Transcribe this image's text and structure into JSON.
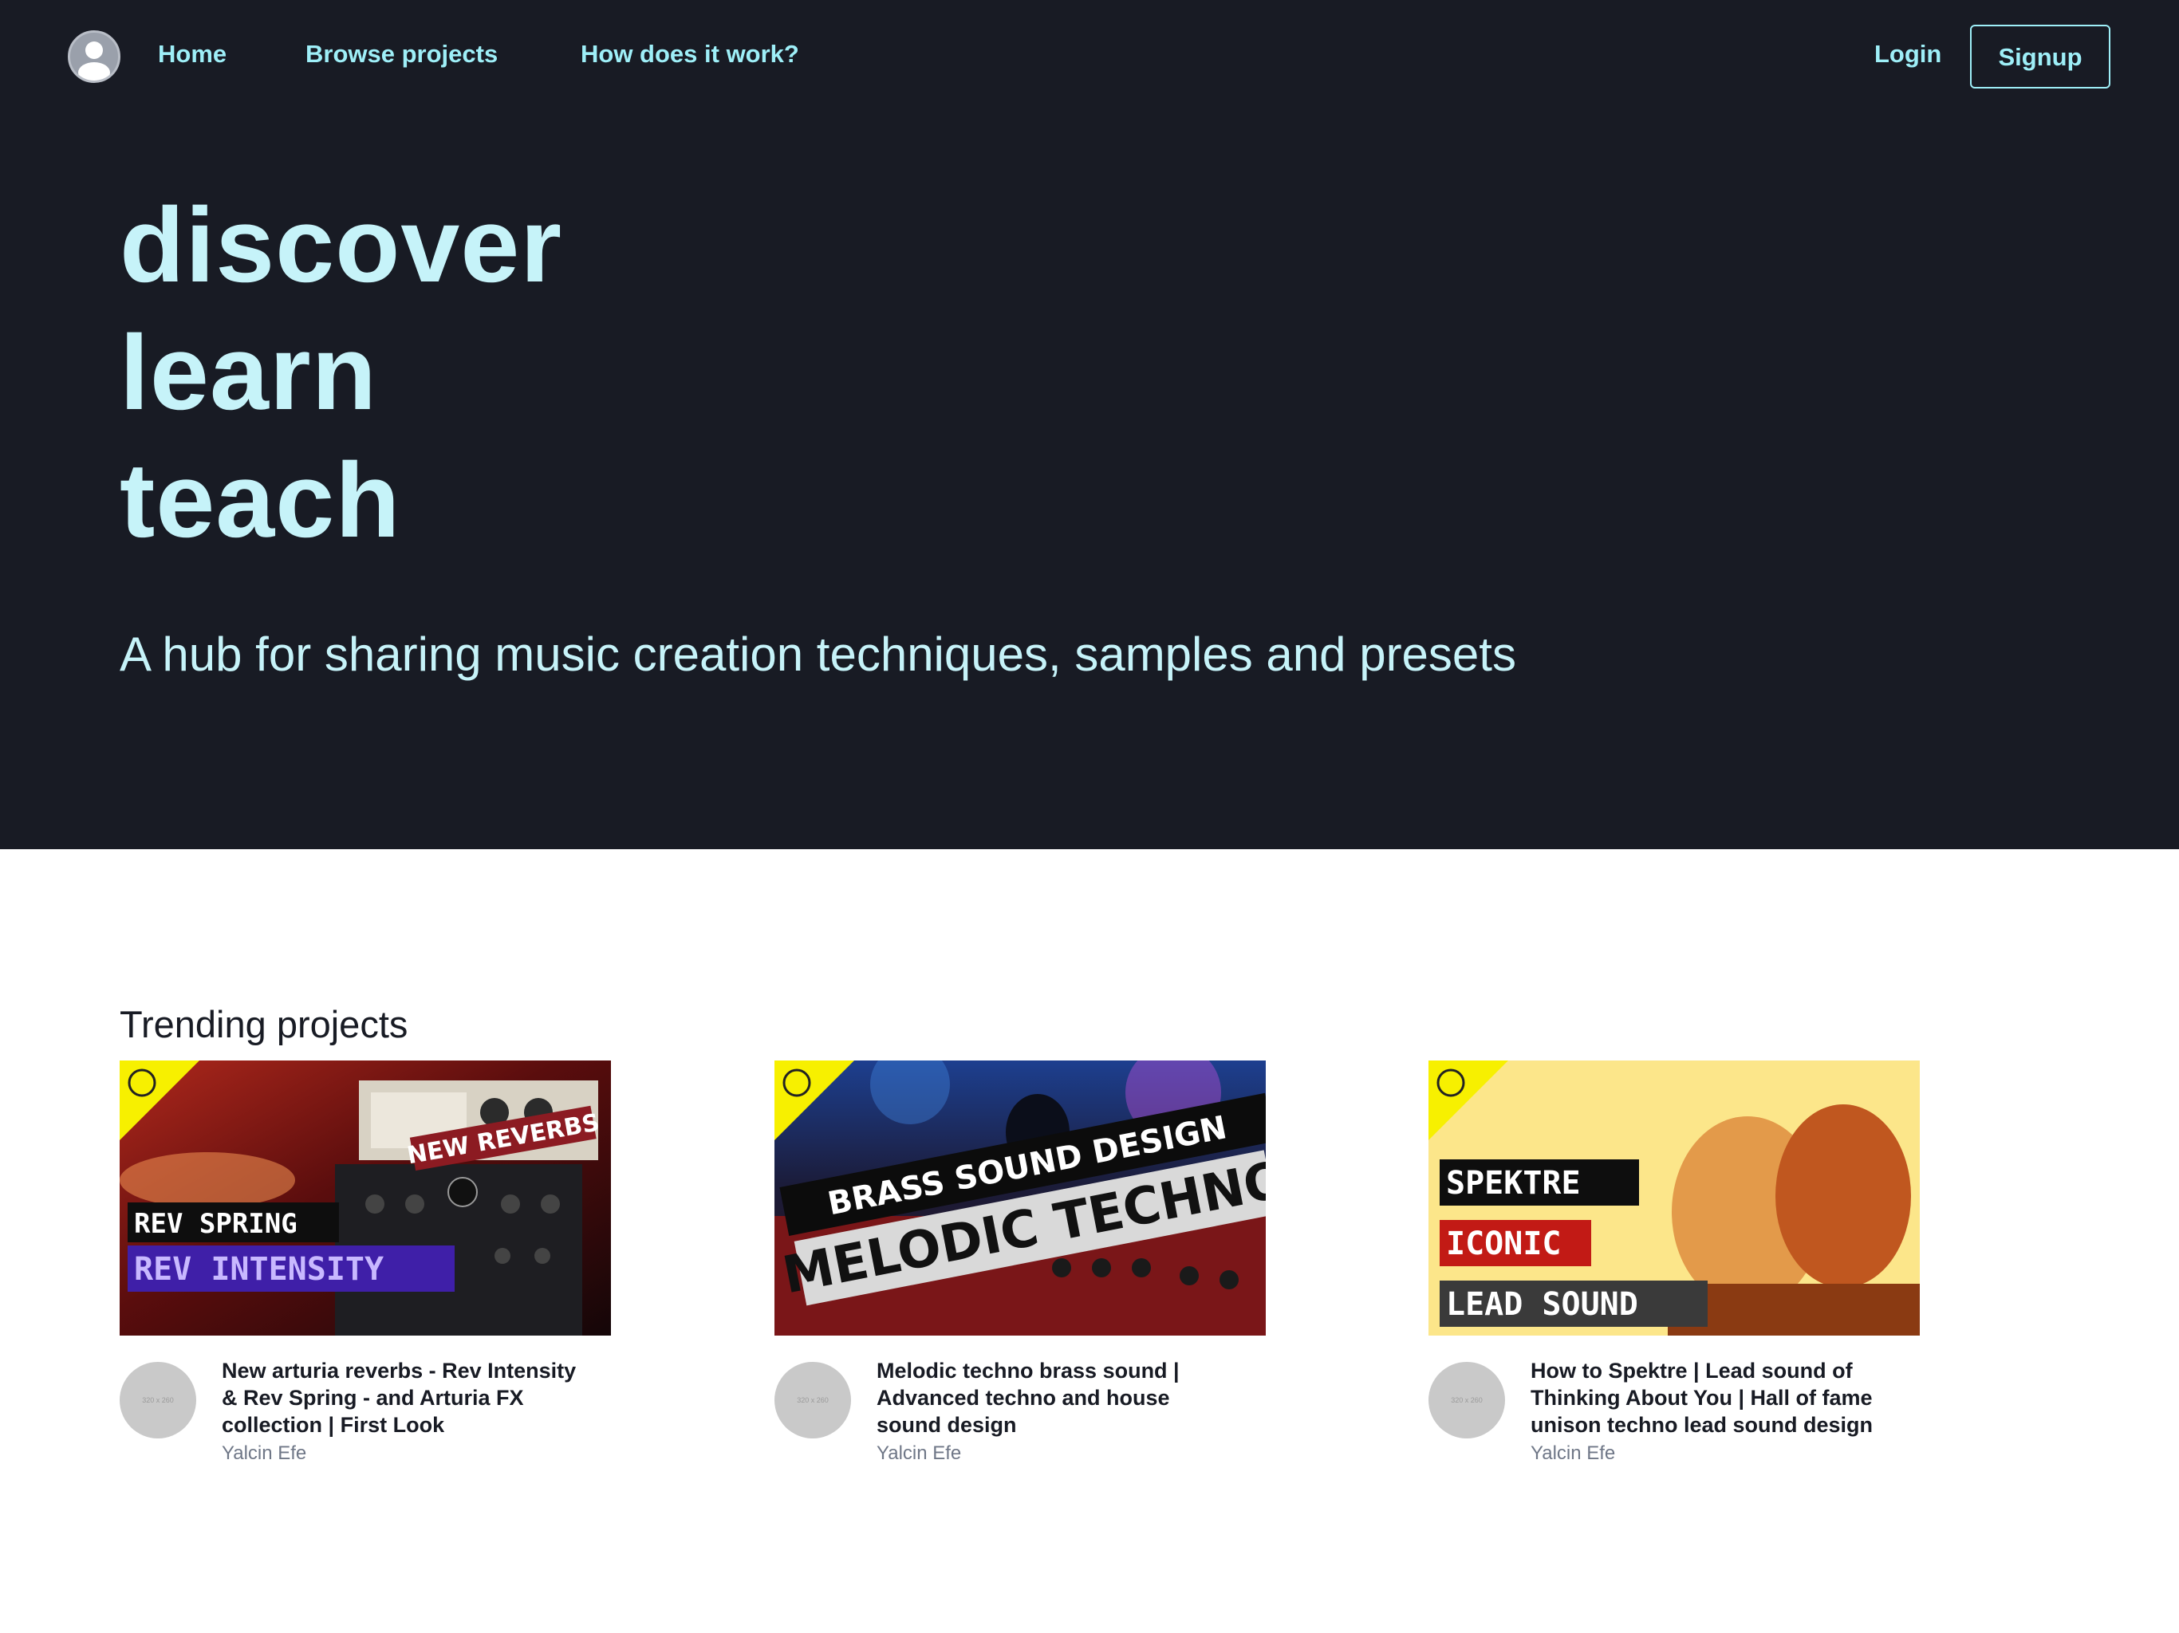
{
  "nav": {
    "home": "Home",
    "browse": "Browse projects",
    "how": "How does it work?",
    "login": "Login",
    "signup": "Signup"
  },
  "hero": {
    "words": [
      "discover",
      "learn",
      "teach"
    ],
    "tagline": "A hub for sharing music creation techniques, samples and presets"
  },
  "trending": {
    "heading": "Trending projects",
    "projects": [
      {
        "title": "New arturia reverbs - Rev Intensity & Rev Spring - and Arturia FX collection | First Look",
        "author": "Yalcin Efe",
        "avatar_placeholder": "320 x 260",
        "thumb_text": [
          "NEW REVERBS",
          "REV SPRING",
          "REV INTENSITY"
        ]
      },
      {
        "title": "Melodic techno brass sound | Advanced techno and house sound design",
        "author": "Yalcin Efe",
        "avatar_placeholder": "320 x 260",
        "thumb_text": [
          "BRASS SOUND DESIGN",
          "MELODIC TECHNO"
        ]
      },
      {
        "title": "How to Spektre | Lead sound of Thinking About You | Hall of fame unison techno lead sound design",
        "author": "Yalcin Efe",
        "avatar_placeholder": "320 x 260",
        "thumb_text": [
          "SPEKTRE",
          "ICONIC",
          "LEAD SOUND"
        ]
      }
    ]
  },
  "colors": {
    "hero_bg": "#181b24",
    "accent": "#9eeff8",
    "hero_text": "#c6f3f9",
    "badge_yellow": "#f7f000"
  }
}
